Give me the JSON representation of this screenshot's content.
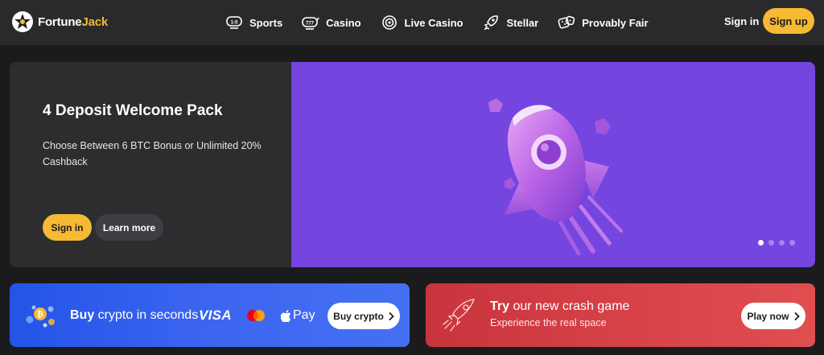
{
  "brand": {
    "name_part1": "Fortune",
    "name_part2": "Jack",
    "accent": "#f6b934"
  },
  "nav": {
    "items": [
      {
        "label": "Sports",
        "icon": "sports-icon"
      },
      {
        "label": "Casino",
        "icon": "slot-machine-icon"
      },
      {
        "label": "Live Casino",
        "icon": "live-casino-icon"
      },
      {
        "label": "Stellar",
        "icon": "rocket-icon"
      },
      {
        "label": "Provably Fair",
        "icon": "dice-icon"
      }
    ],
    "signin": "Sign in",
    "signup": "Sign up"
  },
  "hero": {
    "title": "4 Deposit Welcome Pack",
    "description": "Choose Between 6 BTC Bonus or Unlimited 20% Cashback",
    "signin_label": "Sign in",
    "learn_label": "Learn more",
    "banner_color": "#7545e0",
    "slides_total": 4,
    "active_slide": 1
  },
  "crypto_card": {
    "title_bold": "Buy",
    "title_rest": " crypto in seconds",
    "visa": "VISA",
    "applepay": "Pay",
    "button": "Buy crypto"
  },
  "crash_card": {
    "title_bold": "Try",
    "title_rest": " our new crash game",
    "subtitle": "Experience the real space",
    "button": "Play now"
  }
}
